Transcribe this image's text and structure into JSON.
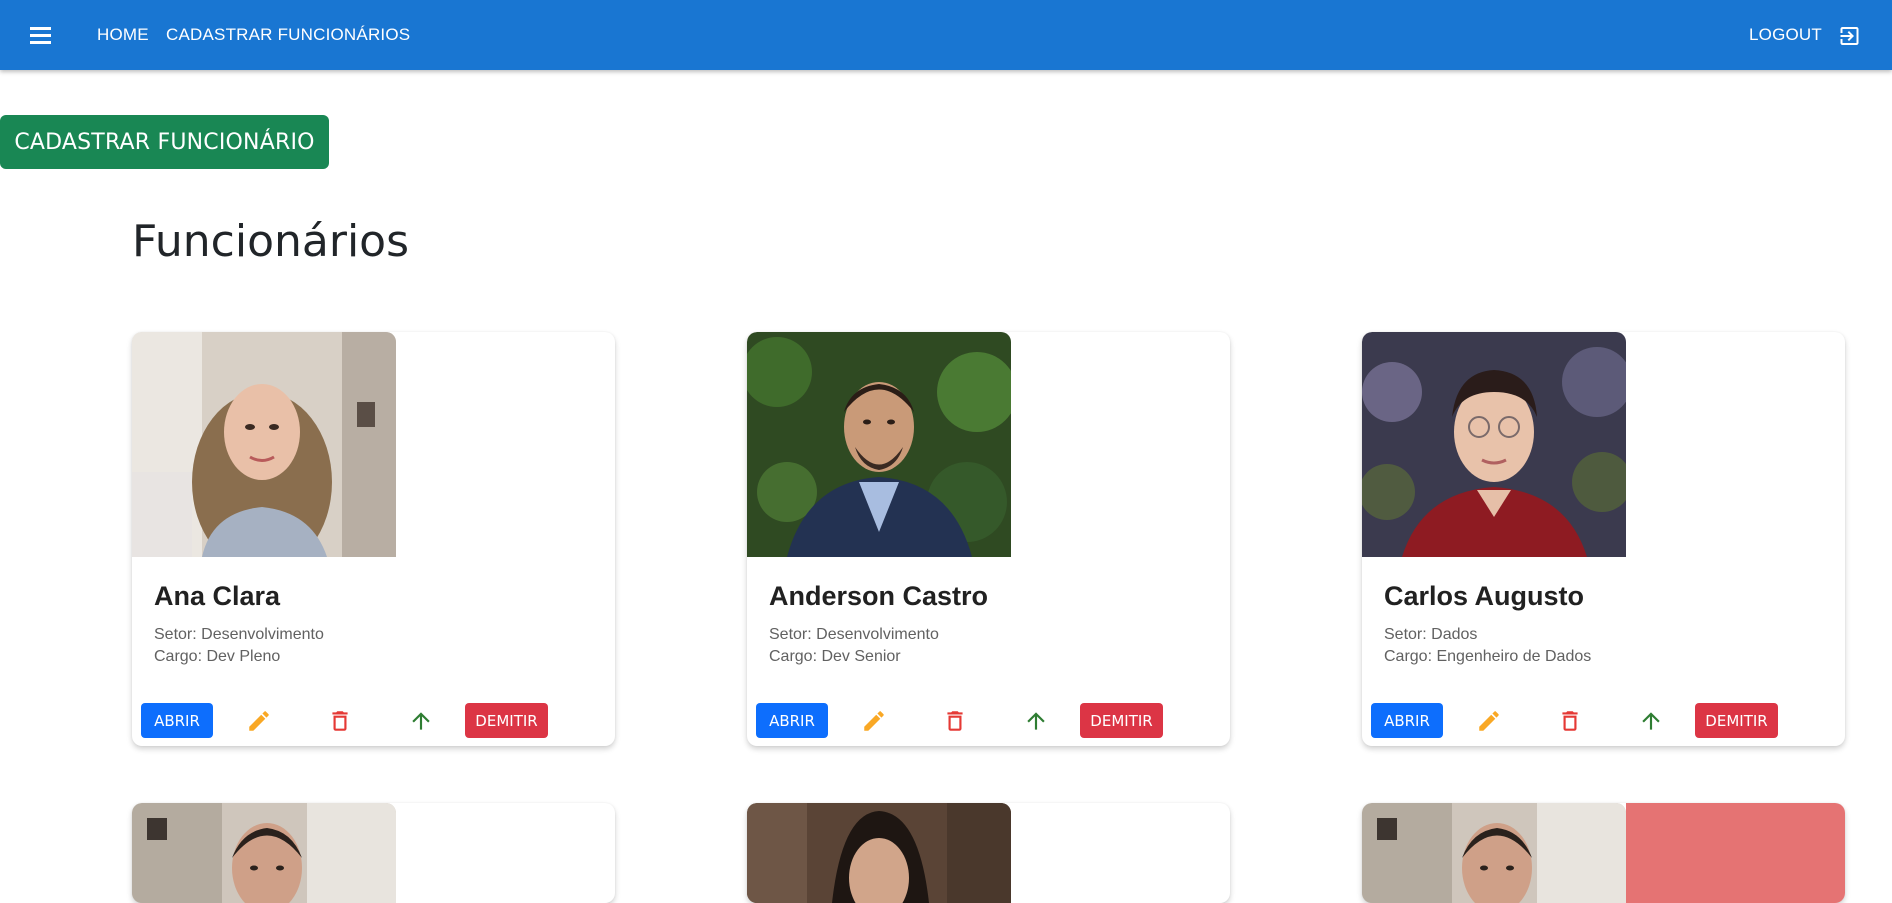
{
  "nav": {
    "home": "HOME",
    "cadastrar": "CADASTRAR FUNCIONÁRIOS",
    "logout": "LOGOUT"
  },
  "actions": {
    "cadastrar_button": "CADASTRAR FUNCIONÁRIO"
  },
  "page": {
    "title": "Funcionários"
  },
  "employees": [
    {
      "name": "Ana Clara",
      "setor": "Setor: Desenvolvimento",
      "cargo": "Cargo: Dev Pleno"
    },
    {
      "name": "Anderson Castro",
      "setor": "Setor: Desenvolvimento",
      "cargo": "Cargo: Dev Senior"
    },
    {
      "name": "Carlos Augusto",
      "setor": "Setor: Dados",
      "cargo": "Cargo: Engenheiro de Dados"
    }
  ],
  "card_buttons": {
    "abrir": "ABRIR",
    "demitir": "DEMITIR"
  },
  "colors": {
    "appbar": "#1976d2",
    "success": "#198754",
    "primary": "#0d6efd",
    "danger": "#dc3545",
    "edit_icon": "#f9a825",
    "delete_icon": "#e53935",
    "promote_icon": "#2e7d32"
  },
  "icons": {
    "menu": "menu-icon",
    "logout": "logout-icon",
    "edit": "pencil-icon",
    "delete": "trash-icon",
    "promote": "arrow-up-icon"
  }
}
